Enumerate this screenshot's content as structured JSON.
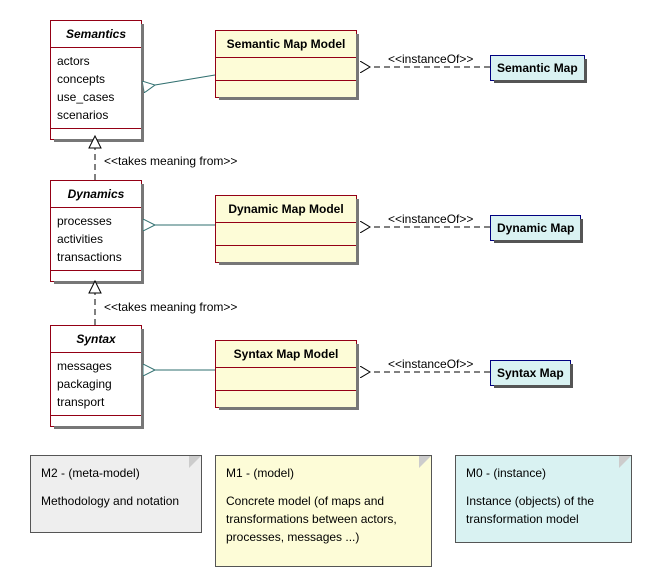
{
  "m2": {
    "semantics": {
      "title": "Semantics",
      "attrs": [
        "actors",
        "concepts",
        "use_cases",
        "scenarios"
      ]
    },
    "dynamics": {
      "title": "Dynamics",
      "attrs": [
        "processes",
        "activities",
        "transactions"
      ]
    },
    "syntax": {
      "title": "Syntax",
      "attrs": [
        "messages",
        "packaging",
        "transport"
      ]
    }
  },
  "m1": {
    "semantic": "Semantic Map Model",
    "dynamic": "Dynamic Map Model",
    "syntax": "Syntax Map Model"
  },
  "m0": {
    "semantic": "Semantic Map",
    "dynamic": "Dynamic Map",
    "syntax": "Syntax Map"
  },
  "stereo": {
    "instance": "<<instanceOf>>",
    "meaning": "<<takes meaning from>>"
  },
  "notes": {
    "m2": {
      "h": "M2  - (meta-model)",
      "b": "Methodology and notation"
    },
    "m1": {
      "h": "M1 - (model)",
      "b": "Concrete model (of maps and transformations between actors, processes, messages ...)"
    },
    "m0": {
      "h": "M0 - (instance)",
      "b": "Instance (objects) of the transformation model"
    }
  }
}
